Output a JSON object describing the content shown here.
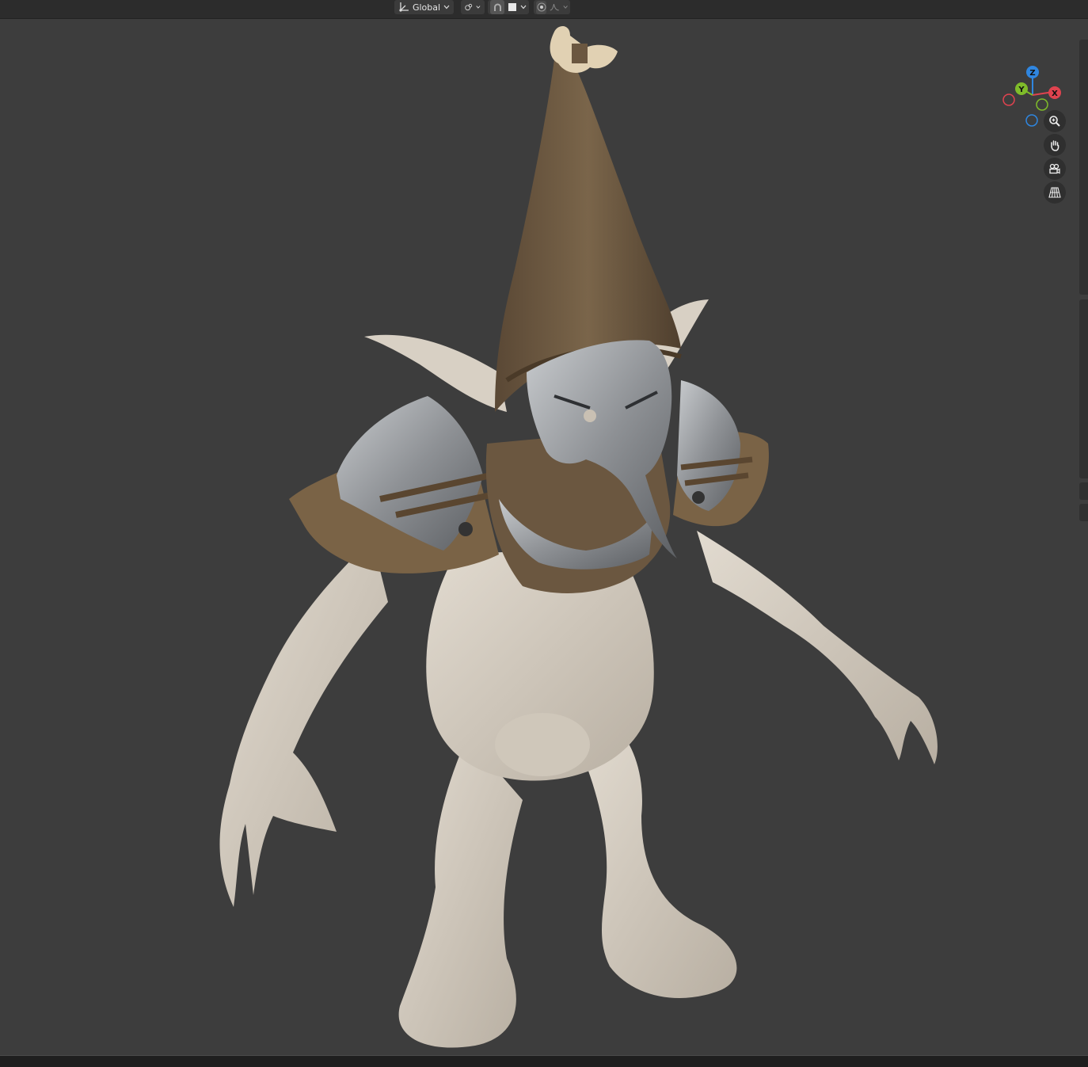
{
  "header": {
    "orientation": {
      "label": "Global",
      "icon": "transform-orientation-icon"
    },
    "pivot": {
      "icon": "pivot-point-icon"
    },
    "snap": {
      "icon": "snap-magnet-icon",
      "element_icon": "snap-increment-icon"
    },
    "proportional": {
      "icon": "proportional-editing-icon",
      "falloff_icon": "falloff-curve-icon"
    }
  },
  "gizmo": {
    "axes": {
      "x": "X",
      "y": "Y",
      "z": "Z"
    },
    "colors": {
      "x": "#e0434f",
      "y": "#7fbc2a",
      "z": "#2f86e0"
    }
  },
  "nav_buttons": [
    {
      "icon": "zoom-icon"
    },
    {
      "icon": "hand-pan-icon"
    },
    {
      "icon": "camera-view-icon"
    },
    {
      "icon": "perspective-grid-icon"
    }
  ],
  "model": {
    "subject": "goblin-character",
    "colors": {
      "skin": "#d4ccc0",
      "hat": "#6e5a42",
      "mask": "#9ea1a5",
      "leather": "#7a6346"
    }
  },
  "theme": {
    "viewport_bg": "#3d3d3d",
    "header_bg": "#2c2c2c"
  }
}
